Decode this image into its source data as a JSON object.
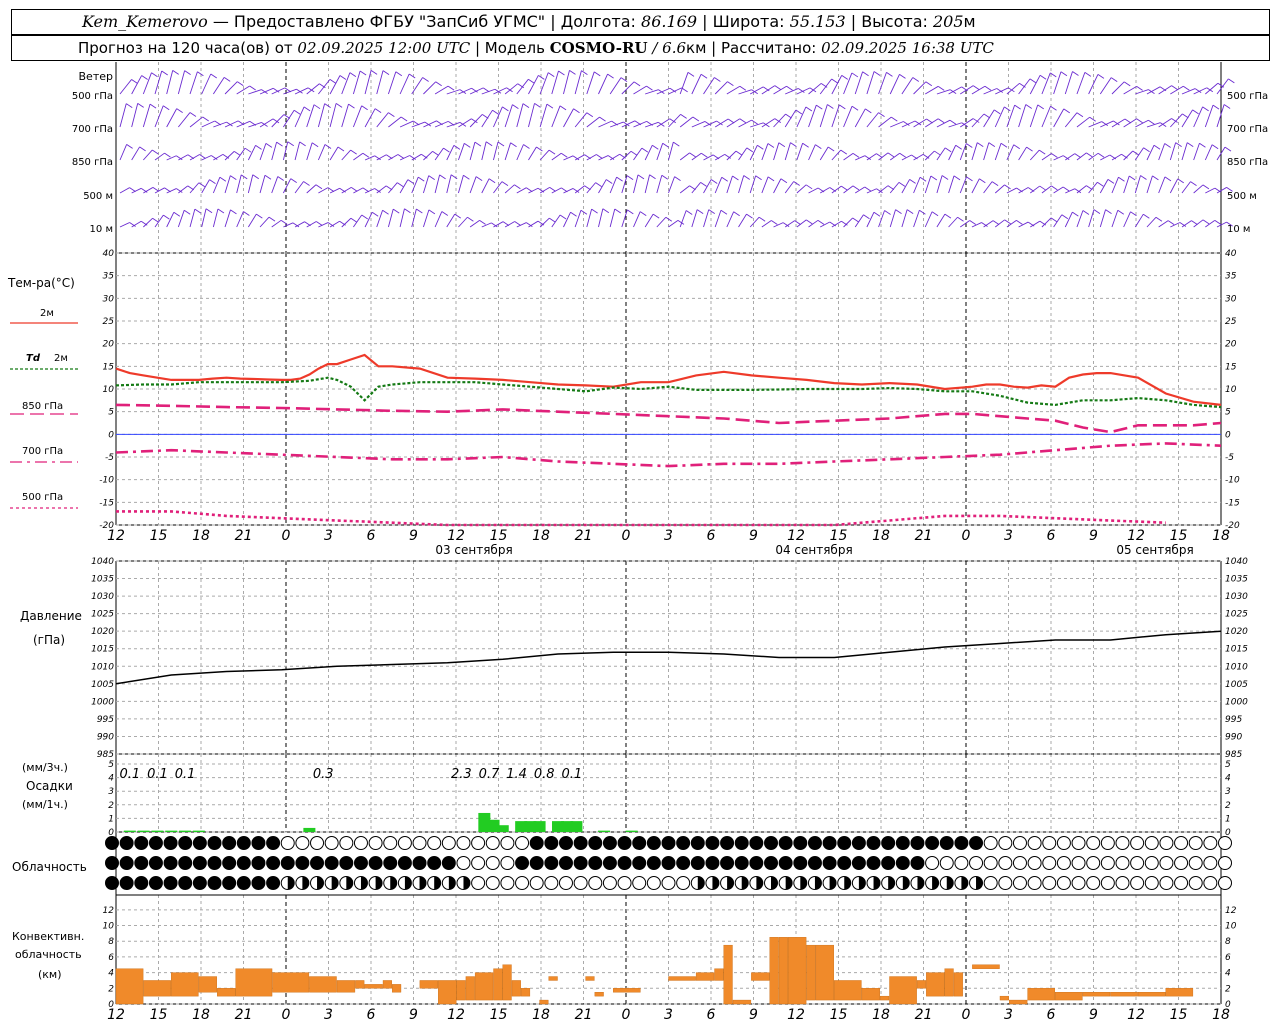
{
  "header": {
    "station": "Kem_Kemerovo",
    "sep1": " — ",
    "provider": "Предоставлено ФГБУ \"ЗапСиб УГМС\"",
    "lon_label": " | Долгота: ",
    "lon_value": "86.169",
    "lat_label": " | Широта: ",
    "lat_value": "55.153",
    "alt_label": " | Высота: ",
    "alt_value": "205",
    "alt_unit": "м",
    "forecast_label": "Прогноз на 120 часа(ов)  от ",
    "forecast_start": "02.09.2025 12:00 UTC",
    "model_label": "  | Модель ",
    "model_name": "COSMO-RU",
    "model_res": " / 6.6",
    "model_res_unit": "км",
    "calc_label": " | Рассчитано: ",
    "calc_time": "02.09.2025 16:38 UTC"
  },
  "time_axis": {
    "tick_labels": [
      "12",
      "15",
      "18",
      "21",
      "0",
      "3",
      "6",
      "9",
      "12",
      "15",
      "18",
      "21",
      "0",
      "3",
      "6",
      "9",
      "12",
      "15",
      "18",
      "21",
      "0",
      "3",
      "6",
      "9",
      "12",
      "15",
      "18"
    ],
    "day_labels": [
      "03 сентября",
      "04 сентября",
      "05 сентября"
    ]
  },
  "wind_panel": {
    "title": "Ветер",
    "levels": [
      "500 гПа",
      "700 гПа",
      "850 гПа",
      "500 м",
      "10   м"
    ],
    "right_levels": [
      "500 гПа",
      "700 гПа",
      "850 гПа",
      "500 м",
      "10   м"
    ]
  },
  "temp_panel": {
    "title": "Тем-ра(°C)",
    "ticks": [
      "40",
      "35",
      "30",
      "25",
      "20",
      "15",
      "10",
      "5",
      "0",
      "-5",
      "-10",
      "-15",
      "-20"
    ],
    "legend": [
      {
        "label": "2м",
        "color": "#ee3a2a"
      },
      {
        "label_italic": "Td",
        "label": "2м",
        "color": "#157a15"
      },
      {
        "label": "850 гПа",
        "color": "#e0207a"
      },
      {
        "label": "700 гПа",
        "color": "#e0207a"
      },
      {
        "label": "500 гПа",
        "color": "#e0207a"
      }
    ]
  },
  "pressure_panel": {
    "title": "Давление",
    "unit": "(гПа)",
    "ticks": [
      "1040",
      "1035",
      "1030",
      "1025",
      "1020",
      "1015",
      "1010",
      "1005",
      "1000",
      "995",
      "990",
      "985"
    ]
  },
  "precip_panel": {
    "unit3": "(мм/3ч.)",
    "title": "Осадки",
    "unit1": "(мм/1ч.)",
    "ticks": [
      "5",
      "4",
      "3",
      "2",
      "1",
      "0"
    ],
    "totals": [
      {
        "h": 1.5,
        "label": "0.1"
      },
      {
        "h": 4.5,
        "label": "0.1"
      },
      {
        "h": 7.5,
        "label": "0.1"
      },
      {
        "h": 22.5,
        "label": "0.3"
      },
      {
        "h": 37.5,
        "label": "2.3"
      },
      {
        "h": 40.5,
        "label": "0.7"
      },
      {
        "h": 43.5,
        "label": "1.4"
      },
      {
        "h": 46.5,
        "label": "0.8"
      },
      {
        "h": 49.5,
        "label": "0.1"
      }
    ],
    "color": "#22cc22"
  },
  "cloud_panel": {
    "title": "Облачность"
  },
  "conv_panel": {
    "title1": "Конвективн.",
    "title2": "облачность",
    "unit": "(км)",
    "ticks": [
      "12",
      "10",
      "8",
      "6",
      "4",
      "2",
      "0"
    ],
    "color": "#f08a2a"
  },
  "chart_data": [
    {
      "type": "line",
      "title": "Тем-ра(°C)",
      "x_unit": "hours since 02.09.2025 12:00 UTC",
      "ylim": [
        -20,
        40
      ],
      "series": [
        {
          "name": "2м",
          "x": [
            0,
            1.5,
            3,
            4.5,
            6,
            7.5,
            9,
            10.5,
            12,
            13.5,
            15,
            16.5,
            18,
            19,
            20,
            21,
            22,
            23,
            24,
            25.5,
            27,
            28.5,
            30,
            33,
            36,
            39,
            42,
            45,
            48,
            51,
            54,
            57,
            60,
            63,
            66,
            69,
            72,
            75,
            78,
            81,
            84,
            87,
            90,
            93,
            94.5,
            96,
            97.5,
            99,
            100.5,
            102,
            103.5,
            105,
            106.5,
            108,
            111,
            114,
            117,
            120
          ],
          "values": [
            14.5,
            13.5,
            13,
            12.5,
            12,
            12,
            12,
            12.3,
            12.5,
            12.3,
            12.2,
            12.1,
            12,
            12,
            12.3,
            13.2,
            14.5,
            15.5,
            15.5,
            16.5,
            17.5,
            15,
            15,
            14.5,
            12.5,
            12.3,
            12,
            11.5,
            11,
            10.8,
            10.5,
            11.5,
            11.5,
            13,
            13.8,
            13,
            12.5,
            12,
            11.3,
            11,
            11.3,
            11,
            10,
            10.5,
            11,
            11,
            10.5,
            10.3,
            10.8,
            10.5,
            12.5,
            13.2,
            13.5,
            13.5,
            12.5,
            9,
            7.2,
            6.5
          ]
        },
        {
          "name": "Td 2м",
          "x": [
            0,
            3,
            6,
            9,
            12,
            15,
            18,
            21,
            23,
            24,
            25.5,
            27,
            28.5,
            30,
            33,
            36,
            39,
            42,
            45,
            48,
            51,
            54,
            57,
            60,
            63,
            66,
            69,
            72,
            75,
            78,
            81,
            84,
            87,
            90,
            93,
            96,
            99,
            102,
            105,
            108,
            111,
            114,
            117,
            120
          ],
          "values": [
            10.8,
            11,
            11,
            11.5,
            11.5,
            11.5,
            11.5,
            11.8,
            12.5,
            12,
            10.5,
            7.5,
            10.5,
            11,
            11.5,
            11.5,
            11.5,
            11,
            10.5,
            10,
            9.5,
            10.3,
            10,
            10.5,
            9.8,
            9.8,
            9.8,
            9.9,
            10,
            10,
            10,
            10.2,
            10,
            9.5,
            9.5,
            8.5,
            7,
            6.5,
            7.5,
            7.5,
            8,
            7.5,
            6.5,
            6
          ]
        },
        {
          "name": "850 гПа",
          "x": [
            0,
            6,
            12,
            18,
            24,
            30,
            36,
            42,
            48,
            54,
            60,
            66,
            72,
            78,
            84,
            90,
            93,
            96,
            99,
            102,
            105,
            108,
            111,
            114,
            117,
            120
          ],
          "values": [
            6.5,
            6.3,
            6,
            5.8,
            5.5,
            5.2,
            5,
            5.5,
            5,
            4.5,
            4,
            3.5,
            2.5,
            3,
            3.5,
            4.5,
            4.5,
            4,
            3.5,
            3,
            1.5,
            0.5,
            2,
            2,
            2,
            2.5
          ]
        },
        {
          "name": "700 гПа",
          "x": [
            0,
            6,
            12,
            18,
            24,
            30,
            36,
            42,
            48,
            54,
            60,
            66,
            72,
            78,
            84,
            90,
            96,
            102,
            108,
            114,
            120
          ],
          "values": [
            -4,
            -3.5,
            -4,
            -4.5,
            -5,
            -5.5,
            -5.5,
            -5,
            -6,
            -6.5,
            -7,
            -6.5,
            -6.5,
            -6,
            -5.5,
            -5,
            -4.5,
            -3.5,
            -2.5,
            -2,
            -2.5
          ]
        },
        {
          "name": "500 гПа",
          "x": [
            0,
            6,
            12,
            18,
            24,
            30,
            36,
            42,
            48,
            54,
            60,
            66,
            72,
            78,
            84,
            90,
            96,
            102,
            108,
            114,
            120
          ],
          "values": [
            -17,
            -17,
            -18,
            -18.5,
            -19,
            -19.5,
            -20,
            -20.5,
            -21,
            -21.5,
            -22,
            -22,
            -21,
            -20,
            -19,
            -18,
            -18,
            -18.5,
            -19,
            -19.5,
            -21
          ]
        }
      ]
    },
    {
      "type": "line",
      "title": "Давление",
      "x_unit": "hours since 02.09.2025 12:00 UTC",
      "ylim": [
        985,
        1040
      ],
      "series": [
        {
          "name": "Давление",
          "x": [
            0,
            6,
            12,
            18,
            24,
            30,
            36,
            42,
            48,
            54,
            60,
            66,
            72,
            78,
            84,
            90,
            96,
            102,
            108,
            114,
            120
          ],
          "values": [
            1005,
            1007.5,
            1008.5,
            1009,
            1010,
            1010.5,
            1011,
            1012,
            1013.5,
            1014,
            1014,
            1013.5,
            1012.5,
            1012.5,
            1014,
            1015.5,
            1016.5,
            1017.5,
            1017.5,
            1019,
            1020
          ]
        }
      ]
    },
    {
      "type": "bar",
      "title": "Осадки",
      "x_unit": "hours since 02.09.2025 12:00 UTC",
      "ylim": [
        0,
        5
      ],
      "x": [
        1.5,
        3,
        4.5,
        6,
        7.5,
        9,
        21,
        40,
        41,
        42,
        44,
        45,
        46,
        48,
        49,
        50,
        53,
        56
      ],
      "values": [
        0.1,
        0.1,
        0.1,
        0.1,
        0.1,
        0.1,
        0.3,
        1.4,
        0.9,
        0.5,
        0.8,
        0.8,
        0.8,
        0.8,
        0.8,
        0.8,
        0.1,
        0.1
      ]
    },
    {
      "type": "bar",
      "title": "Конвективн. облачность",
      "x_unit": "hours since 02.09.2025 12:00 UTC",
      "ylim": [
        0,
        13
      ],
      "bars": [
        {
          "x0": 0,
          "x1": 3,
          "lo": 0,
          "hi": 4.5
        },
        {
          "x0": 3,
          "x1": 6,
          "lo": 1,
          "hi": 3
        },
        {
          "x0": 6,
          "x1": 9,
          "lo": 1,
          "hi": 4
        },
        {
          "x0": 9,
          "x1": 11,
          "lo": 1.5,
          "hi": 3.5
        },
        {
          "x0": 11,
          "x1": 13,
          "lo": 1,
          "hi": 2
        },
        {
          "x0": 13,
          "x1": 17,
          "lo": 1,
          "hi": 4.5
        },
        {
          "x0": 17,
          "x1": 21,
          "lo": 1.5,
          "hi": 4
        },
        {
          "x0": 21,
          "x1": 24,
          "lo": 1.5,
          "hi": 3.5
        },
        {
          "x0": 24,
          "x1": 26,
          "lo": 1.5,
          "hi": 3
        },
        {
          "x0": 26,
          "x1": 27,
          "lo": 2,
          "hi": 3
        },
        {
          "x0": 27,
          "x1": 29,
          "lo": 2,
          "hi": 2.5
        },
        {
          "x0": 29,
          "x1": 30,
          "lo": 2,
          "hi": 3
        },
        {
          "x0": 30,
          "x1": 31,
          "lo": 1.5,
          "hi": 2.5
        },
        {
          "x0": 33,
          "x1": 35,
          "lo": 2,
          "hi": 3
        },
        {
          "x0": 35,
          "x1": 37,
          "lo": 0,
          "hi": 3
        },
        {
          "x0": 37,
          "x1": 38,
          "lo": 0.5,
          "hi": 3
        },
        {
          "x0": 38,
          "x1": 39,
          "lo": 0.5,
          "hi": 3.5
        },
        {
          "x0": 39,
          "x1": 41,
          "lo": 0.5,
          "hi": 4
        },
        {
          "x0": 41,
          "x1": 42,
          "lo": 0.5,
          "hi": 4.5
        },
        {
          "x0": 42,
          "x1": 43,
          "lo": 0.5,
          "hi": 5
        },
        {
          "x0": 43,
          "x1": 44,
          "lo": 1,
          "hi": 3
        },
        {
          "x0": 44,
          "x1": 45,
          "lo": 1,
          "hi": 2
        },
        {
          "x0": 46,
          "x1": 47,
          "lo": 0,
          "hi": 0.5
        },
        {
          "x0": 47,
          "x1": 48,
          "lo": 3,
          "hi": 3.5
        },
        {
          "x0": 51,
          "x1": 52,
          "lo": 3,
          "hi": 3.5
        },
        {
          "x0": 52,
          "x1": 53,
          "lo": 1,
          "hi": 1.5
        },
        {
          "x0": 54,
          "x1": 57,
          "lo": 1.5,
          "hi": 2
        },
        {
          "x0": 60,
          "x1": 63,
          "lo": 3,
          "hi": 3.5
        },
        {
          "x0": 63,
          "x1": 65,
          "lo": 3,
          "hi": 4
        },
        {
          "x0": 65,
          "x1": 66,
          "lo": 3,
          "hi": 4.5
        },
        {
          "x0": 66,
          "x1": 67,
          "lo": 0,
          "hi": 7.5
        },
        {
          "x0": 67,
          "x1": 69,
          "lo": 0,
          "hi": 0.5
        },
        {
          "x0": 69,
          "x1": 71,
          "lo": 3,
          "hi": 4
        },
        {
          "x0": 71,
          "x1": 72,
          "lo": 0,
          "hi": 8.5
        },
        {
          "x0": 72,
          "x1": 73,
          "lo": 0,
          "hi": 8.5
        },
        {
          "x0": 73,
          "x1": 75,
          "lo": 0,
          "hi": 8.5
        },
        {
          "x0": 75,
          "x1": 76,
          "lo": 0.5,
          "hi": 7.5
        },
        {
          "x0": 76,
          "x1": 78,
          "lo": 0.5,
          "hi": 7.5
        },
        {
          "x0": 78,
          "x1": 81,
          "lo": 0.5,
          "hi": 3
        },
        {
          "x0": 81,
          "x1": 83,
          "lo": 0.5,
          "hi": 2
        },
        {
          "x0": 83,
          "x1": 84,
          "lo": 0.5,
          "hi": 1
        },
        {
          "x0": 84,
          "x1": 87,
          "lo": 0,
          "hi": 3.5
        },
        {
          "x0": 87,
          "x1": 88,
          "lo": 2,
          "hi": 3
        },
        {
          "x0": 88,
          "x1": 90,
          "lo": 1,
          "hi": 4
        },
        {
          "x0": 90,
          "x1": 91,
          "lo": 1,
          "hi": 4.5
        },
        {
          "x0": 91,
          "x1": 92,
          "lo": 1,
          "hi": 4
        },
        {
          "x0": 93,
          "x1": 96,
          "lo": 4.5,
          "hi": 5
        },
        {
          "x0": 96,
          "x1": 97,
          "lo": 0.5,
          "hi": 1
        },
        {
          "x0": 97,
          "x1": 99,
          "lo": 0,
          "hi": 0.5
        },
        {
          "x0": 99,
          "x1": 102,
          "lo": 0.5,
          "hi": 2
        },
        {
          "x0": 102,
          "x1": 105,
          "lo": 0.5,
          "hi": 1.5
        },
        {
          "x0": 105,
          "x1": 108,
          "lo": 1,
          "hi": 1.5
        },
        {
          "x0": 108,
          "x1": 111,
          "lo": 1,
          "hi": 1.5
        },
        {
          "x0": 111,
          "x1": 114,
          "lo": 1,
          "hi": 1.5
        },
        {
          "x0": 114,
          "x1": 117,
          "lo": 1,
          "hi": 2
        }
      ]
    }
  ]
}
